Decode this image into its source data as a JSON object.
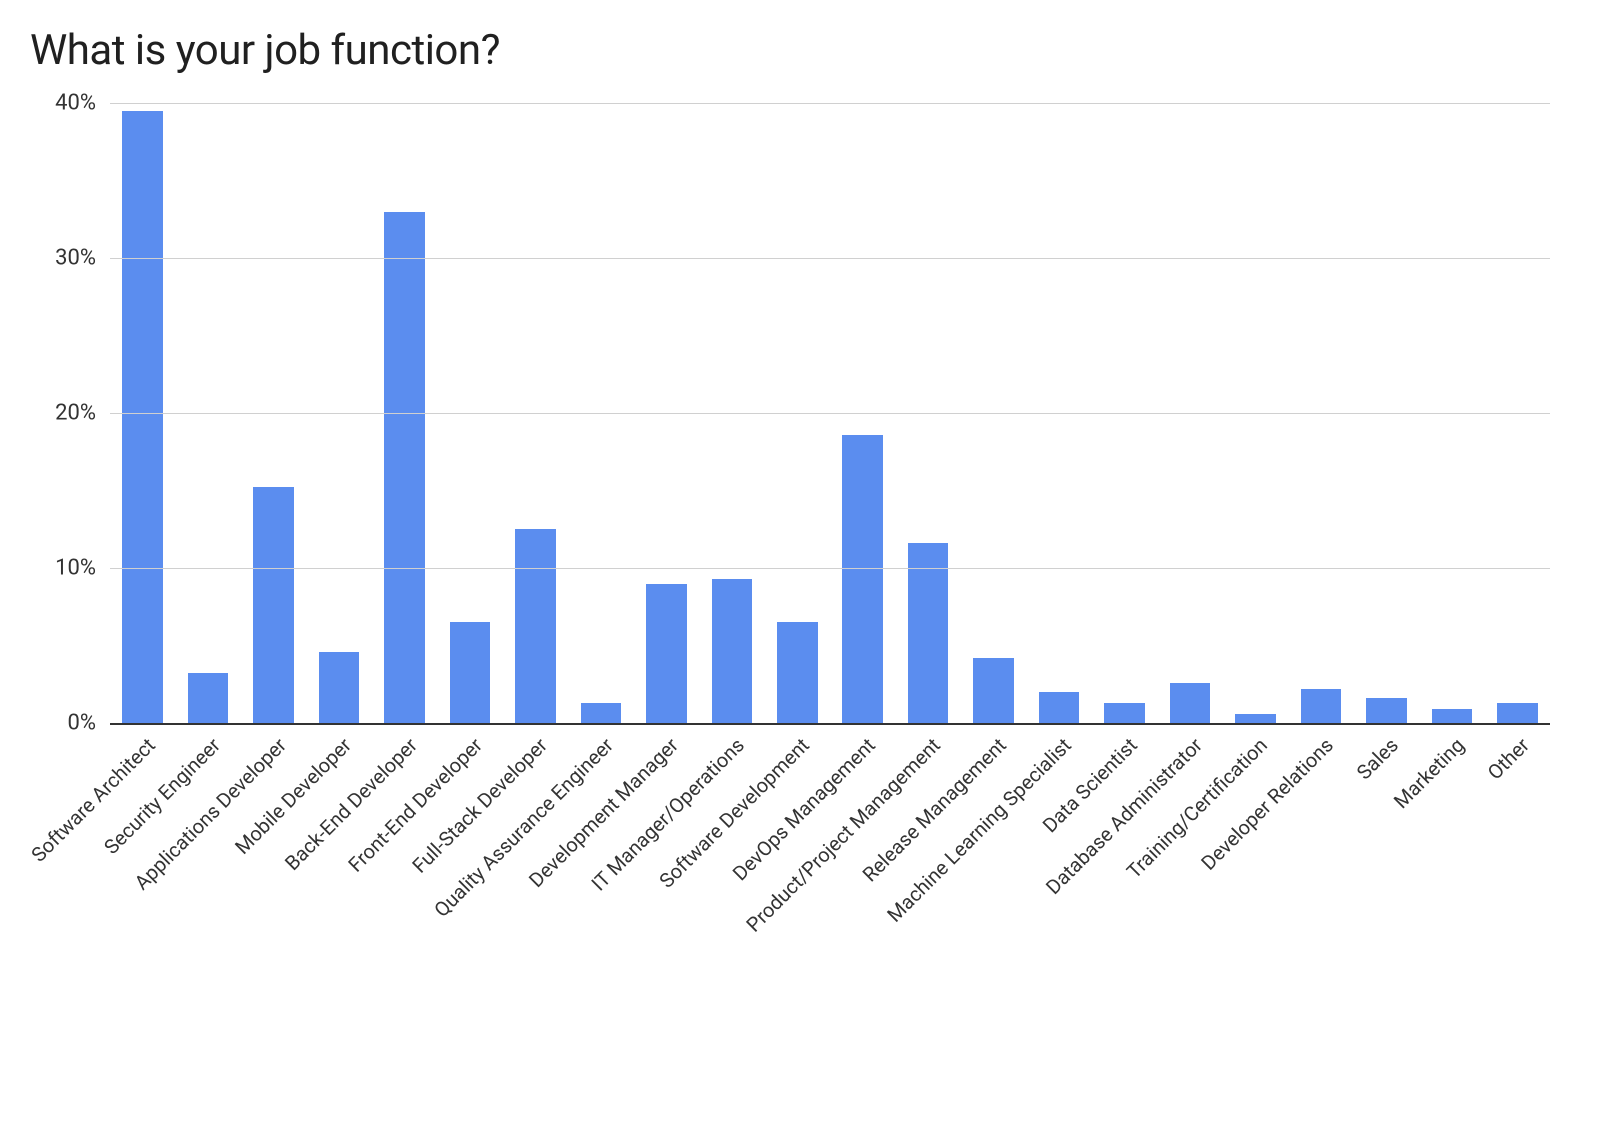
{
  "chart_data": {
    "type": "bar",
    "title": "What is your job function?",
    "xlabel": "",
    "ylabel": "",
    "ylim": [
      0,
      40
    ],
    "yticks": [
      0,
      10,
      20,
      30,
      40
    ],
    "ytick_format": "percent",
    "bar_color": "#5b8def",
    "categories": [
      "Software Architect",
      "Security Engineer",
      "Applications Developer",
      "Mobile Developer",
      "Back-End Developer",
      "Front-End Developer",
      "Full-Stack Developer",
      "Quality Assurance Engineer",
      "Development Manager",
      "IT Manager/Operations",
      "Software Development",
      "DevOps Management",
      "Product/Project Management",
      "Release Management",
      "Machine Learning Specialist",
      "Data Scientist",
      "Database Administrator",
      "Training/Certification",
      "Developer Relations",
      "Sales",
      "Marketing",
      "Other"
    ],
    "values": [
      39.5,
      3.2,
      15.2,
      4.6,
      33.0,
      6.5,
      12.5,
      1.3,
      9.0,
      9.3,
      6.5,
      18.6,
      11.6,
      4.2,
      2.0,
      1.3,
      2.6,
      0.6,
      2.2,
      1.6,
      0.9,
      1.3
    ]
  }
}
